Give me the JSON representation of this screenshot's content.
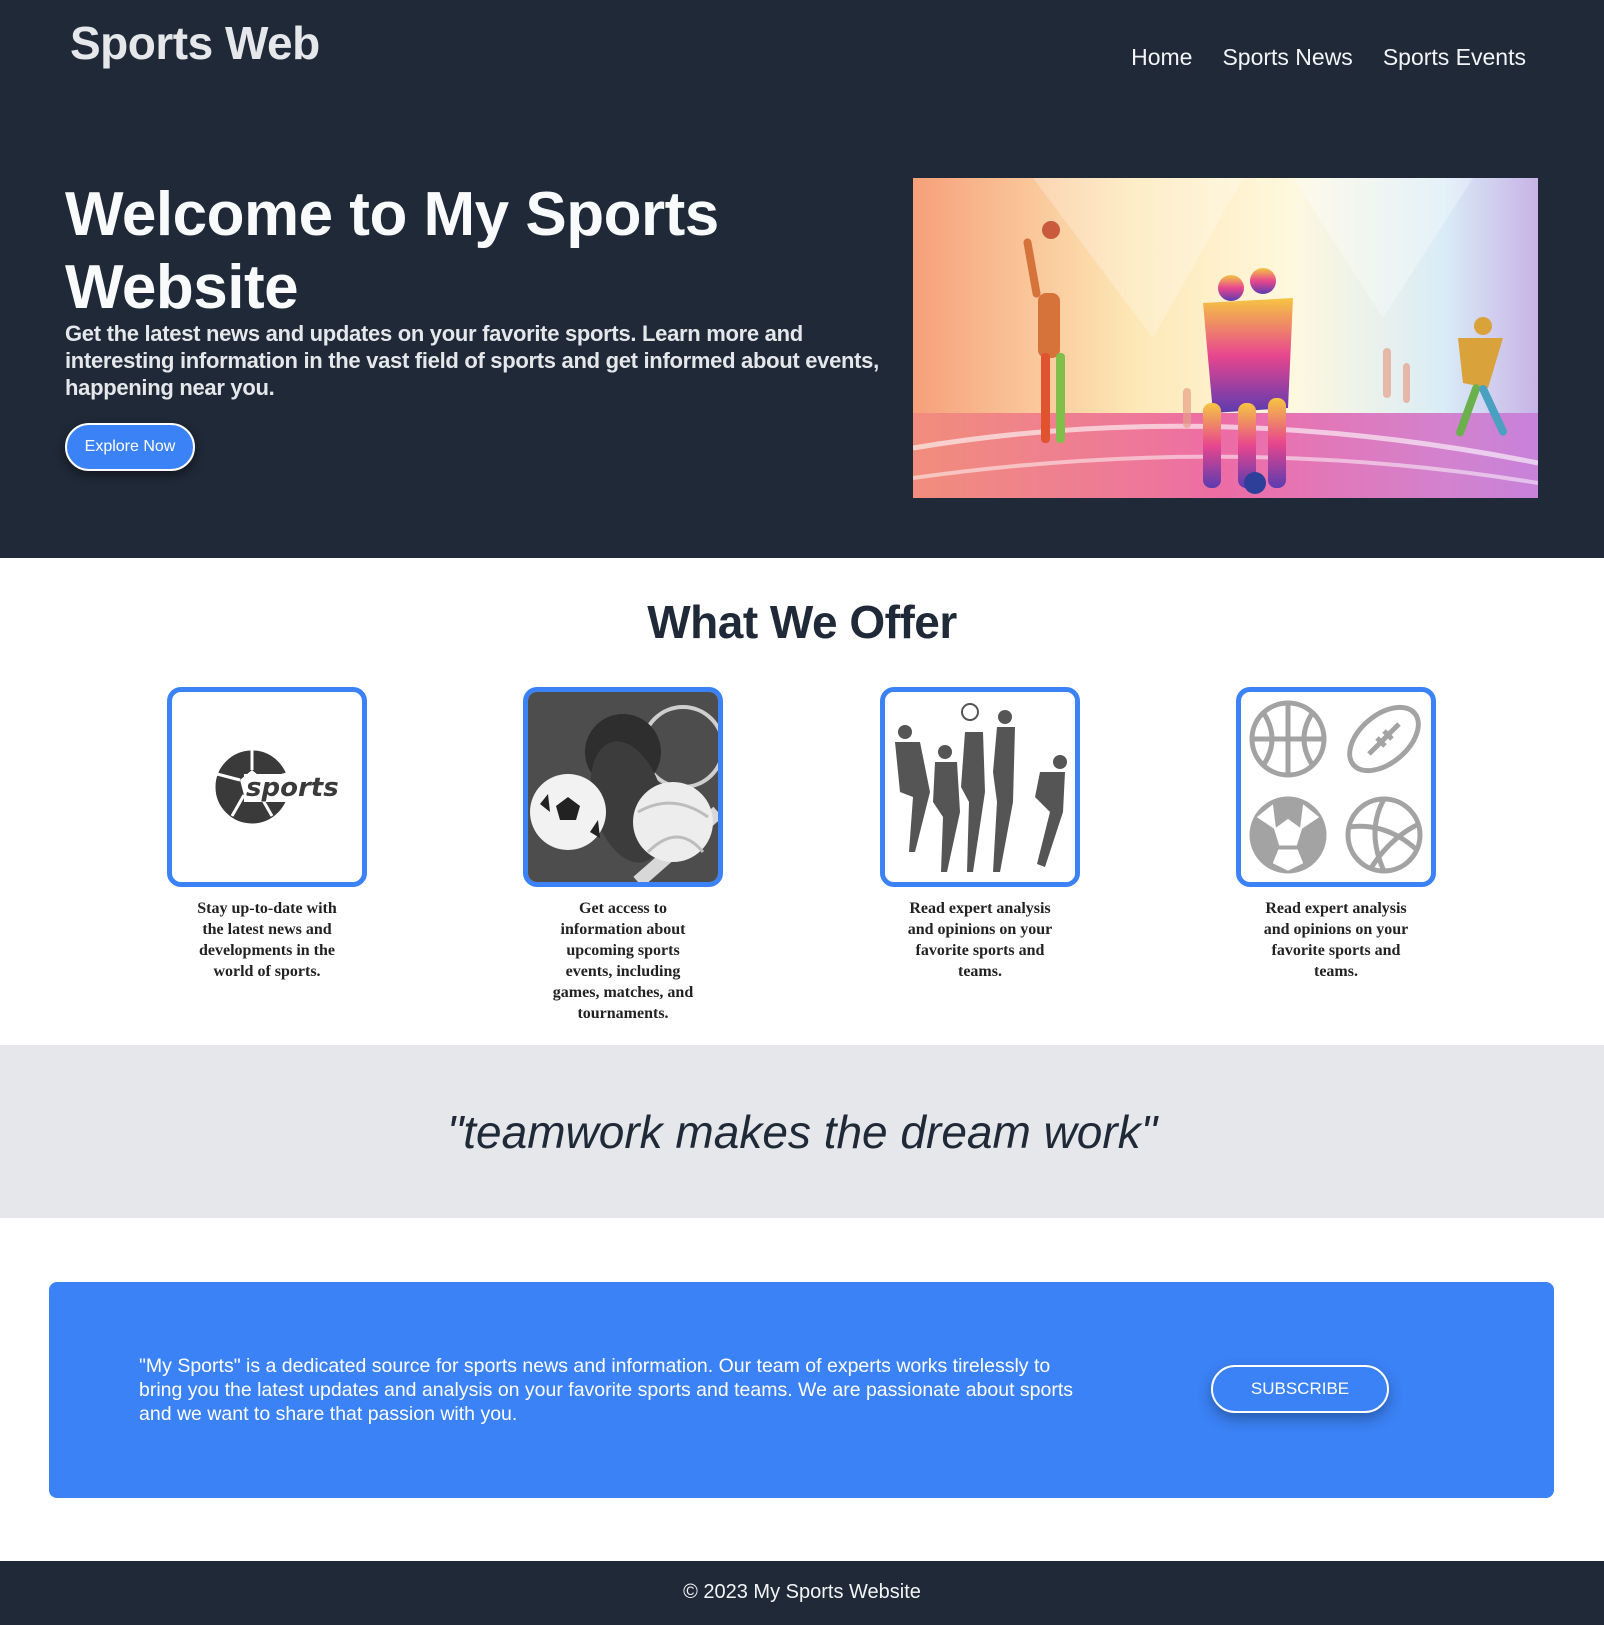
{
  "header": {
    "brand": "Sports Web",
    "nav": [
      {
        "label": "Home"
      },
      {
        "label": "Sports News"
      },
      {
        "label": "Sports Events"
      }
    ]
  },
  "hero": {
    "title": "Welcome to My Sports Website",
    "subtitle": "Get the latest news and updates on your favorite sports. Learn more and interesting information in the vast field of sports and get informed about events, happening near you.",
    "cta_label": "Explore Now",
    "image_icon": "sports-players-illustration"
  },
  "offer": {
    "title": "What We Offer",
    "items": [
      {
        "icon": "sports-logo-icon",
        "text": "Stay up-to-date with the latest news and developments in the world of sports.",
        "logo_text": "sports"
      },
      {
        "icon": "sports-balls-photo",
        "text": "Get access to information about upcoming sports events, including games, matches, and tournaments."
      },
      {
        "icon": "athletes-silhouettes-photo",
        "text": "Read expert analysis and opinions on your favorite sports and teams."
      },
      {
        "icon": "balls-icon-grid",
        "text": "Read expert analysis and opinions on your favorite sports and teams."
      }
    ]
  },
  "quote": {
    "text": "\"teamwork makes the dream work\""
  },
  "about": {
    "text": "\"My Sports\" is a dedicated source for sports news and information. Our team of experts works tirelessly to bring you the latest updates and analysis on your favorite sports and teams. We are passionate about sports and we want to share that passion with you.",
    "subscribe_label": "SUBSCRIBE"
  },
  "footer": {
    "text": "© 2023 My Sports Website"
  },
  "colors": {
    "dark": "#1f2937",
    "accent": "#3b82f6",
    "band": "#e5e7eb"
  }
}
